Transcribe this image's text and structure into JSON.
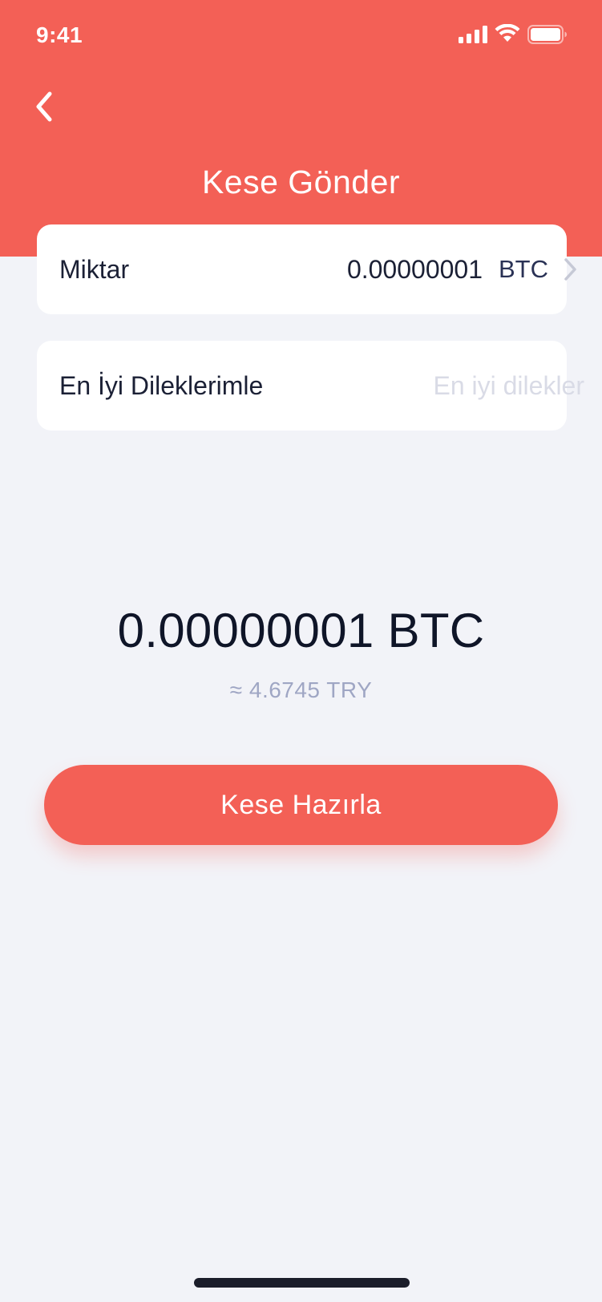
{
  "status_bar": {
    "time": "9:41",
    "icons": [
      "signal-icon",
      "wifi-icon",
      "battery-icon"
    ]
  },
  "header": {
    "back_icon": "chevron-left-icon",
    "title": "Kese Gönder"
  },
  "amount_row": {
    "label": "Miktar",
    "value": "0.00000001",
    "unit": "BTC",
    "icon": "chevron-right-icon"
  },
  "message_row": {
    "label": "En İyi Dileklerimle",
    "value": "",
    "placeholder": "En iyi dilekler"
  },
  "summary": {
    "total": "0.00000001 BTC",
    "approx": "≈ 4.6745 TRY"
  },
  "actions": {
    "prepare_label": "Kese Hazırla"
  },
  "colors": {
    "accent": "#f36056",
    "background": "#f2f3f8",
    "card": "#ffffff",
    "text_primary": "#0f1528",
    "text_muted": "#9fa6c4",
    "placeholder": "#d9dbe6"
  }
}
